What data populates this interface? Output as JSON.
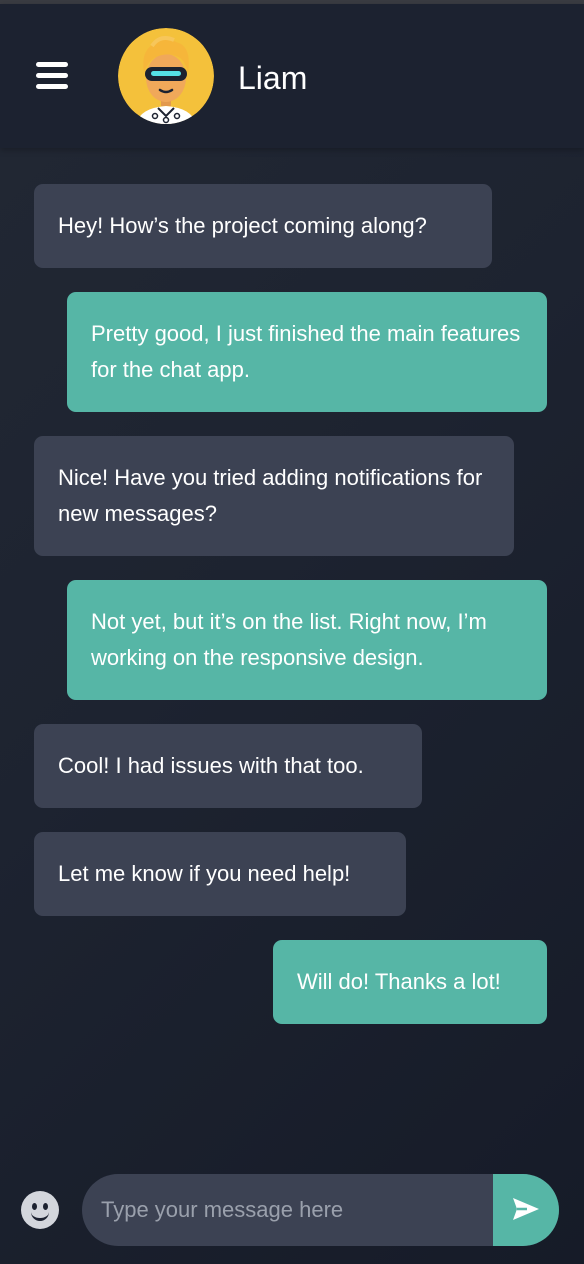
{
  "header": {
    "contact_name": "Liam",
    "menu_icon": "hamburger-menu-icon",
    "avatar_icon": "robot-avatar"
  },
  "messages": [
    {
      "direction": "incoming",
      "text": "Hey! How’s the project coming along?"
    },
    {
      "direction": "outgoing",
      "text": "Pretty good, I just finished the main features for the chat app."
    },
    {
      "direction": "incoming",
      "text": "Nice! Have you tried adding notifications for new messages?"
    },
    {
      "direction": "outgoing",
      "text": "Not yet, but it’s on the list. Right now, I’m working on the responsive design."
    },
    {
      "direction": "incoming",
      "text": "Cool! I had issues with that too."
    },
    {
      "direction": "incoming",
      "text": "Let me know if you need help!"
    },
    {
      "direction": "outgoing",
      "text": "Will do! Thanks a lot!"
    }
  ],
  "composer": {
    "placeholder": "Type your message here",
    "value": "",
    "emoji_icon": "smiley-icon",
    "send_icon": "send-icon"
  },
  "colors": {
    "background": "#1c2230",
    "incoming_bubble": "#3c4253",
    "outgoing_bubble": "#56b6a6",
    "text": "#ffffff"
  }
}
